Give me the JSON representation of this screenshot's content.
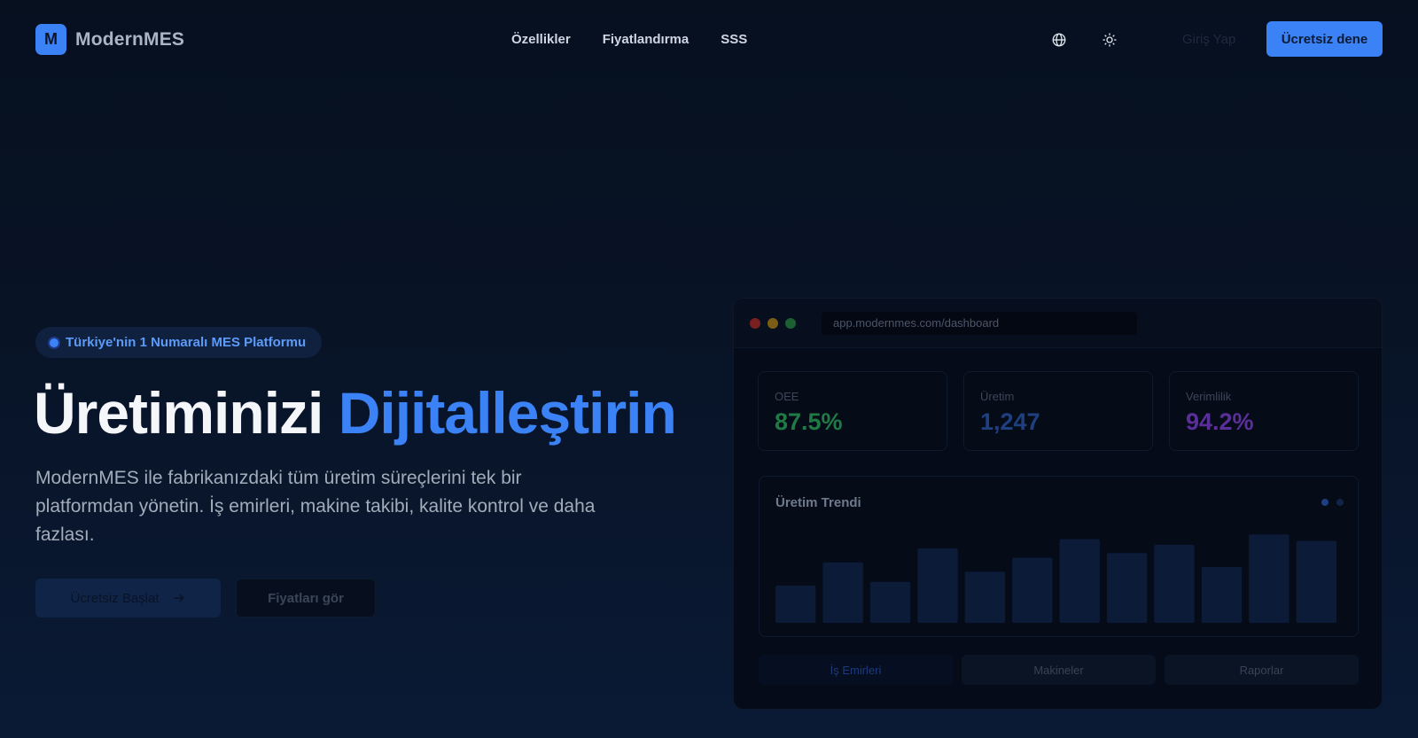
{
  "header": {
    "logo_letter": "M",
    "brand": "ModernMES",
    "nav": [
      {
        "label": "Özellikler"
      },
      {
        "label": "Fiyatlandırma"
      },
      {
        "label": "SSS"
      }
    ],
    "login_label": "Giriş Yap",
    "cta_label": "Ücretsiz dene",
    "icons": [
      "globe-icon",
      "sun-icon"
    ]
  },
  "hero": {
    "badge": "Türkiye'nin 1 Numaralı MES Platformu",
    "title_part1": "Üretiminizi ",
    "title_part2": "Dijitalleştirin",
    "description": "ModernMES ile fabrikanızdaki tüm üretim süreçlerini tek bir platformdan yönetin. İş emirleri, makine takibi, kalite kontrol ve daha fazlası.",
    "primary_button": "Ücretsiz Başlat",
    "secondary_button": "Fiyatları gör"
  },
  "dashboard": {
    "url": "app.modernmes.com/dashboard",
    "kpis": [
      {
        "label": "OEE",
        "value": "87.5%",
        "color": "#1f7a45"
      },
      {
        "label": "Üretim",
        "value": "1,247",
        "color": "#1e3f80"
      },
      {
        "label": "Verimlilik",
        "value": "94.2%",
        "color": "#5b2f9a"
      }
    ],
    "trend_title": "Üretim Trendi",
    "tabs": [
      {
        "label": "İş Emirleri",
        "color": "#1e3a7a"
      },
      {
        "label": "Makineler",
        "color": "#3a4354"
      },
      {
        "label": "Raporlar",
        "color": "#3a4354"
      }
    ]
  },
  "colors": {
    "accent": "#3b82f6",
    "background": "#081326",
    "bar": "#0c1b38"
  },
  "chart_data": {
    "type": "bar",
    "title": "Üretim Trendi",
    "categories": [
      "",
      "",
      "",
      "",
      "",
      "",
      "",
      "",
      "",
      "",
      "",
      ""
    ],
    "values": [
      40,
      65,
      44,
      80,
      55,
      70,
      90,
      75,
      84,
      60,
      95,
      88
    ],
    "ylim": [
      0,
      100
    ],
    "grid": false
  }
}
